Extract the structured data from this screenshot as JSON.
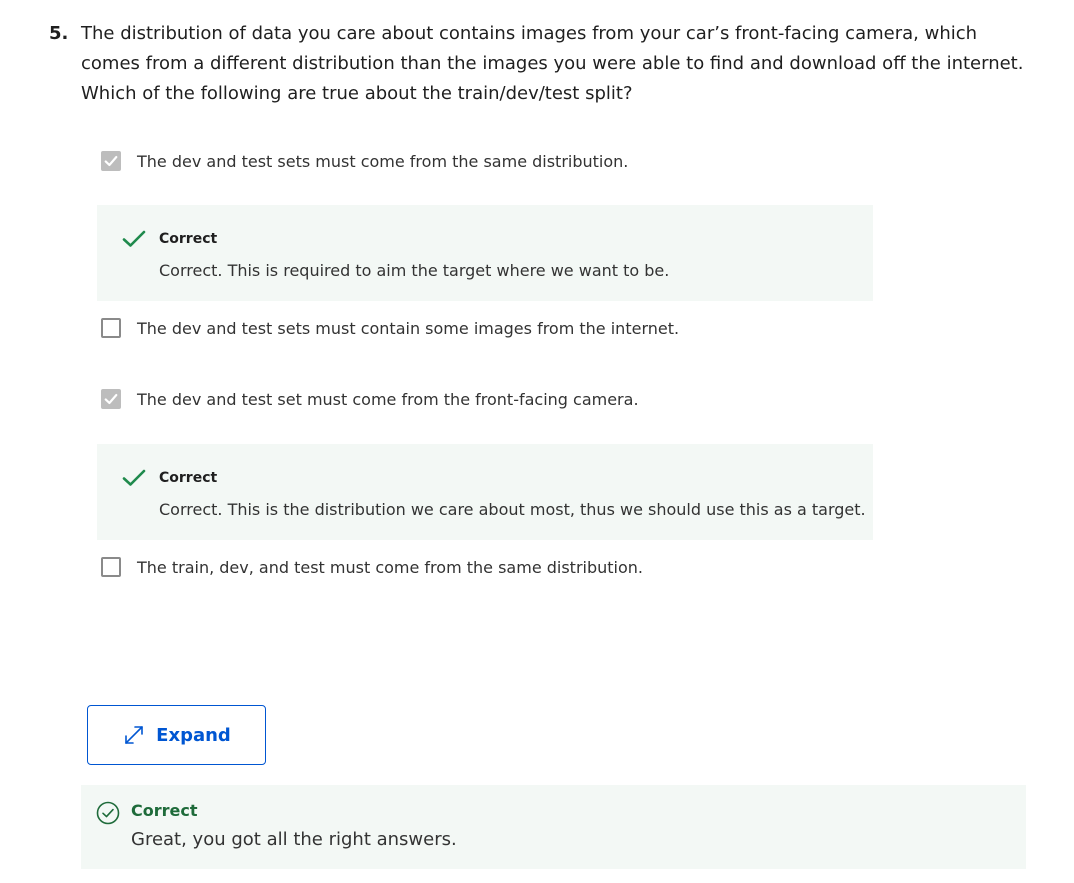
{
  "question": {
    "number": "5.",
    "text": "The distribution of data you care about contains images from your car’s front-facing camera, which comes from a different distribution than the images you were able to find and download off the internet. Which of the following are true about the train/dev/test split?"
  },
  "options": [
    {
      "label": "The dev and test sets must come from the same distribution.",
      "checked": true,
      "feedback": {
        "title": "Correct",
        "text": "Correct. This is required to aim the target where we want to be."
      }
    },
    {
      "label": "The dev and test sets must contain some images from the internet.",
      "checked": false
    },
    {
      "label": "The dev and test set must come from the front-facing camera.",
      "checked": true,
      "feedback": {
        "title": "Correct",
        "text": "Correct. This is the distribution we care about most, thus we should use this as a target."
      }
    },
    {
      "label": "The train, dev, and test must come from the same distribution.",
      "checked": false
    }
  ],
  "expand_button": {
    "label": "Expand",
    "icon": "expand-arrows-icon"
  },
  "result": {
    "title": "Correct",
    "text": "Great, you got all the right answers.",
    "icon": "circle-check-icon"
  },
  "colors": {
    "accent": "#0056d2",
    "correct_green": "#1e6b3a",
    "check_green": "#1f8a4c",
    "feedback_bg": "#f3f8f5",
    "checked_box": "#bdbdbd"
  }
}
